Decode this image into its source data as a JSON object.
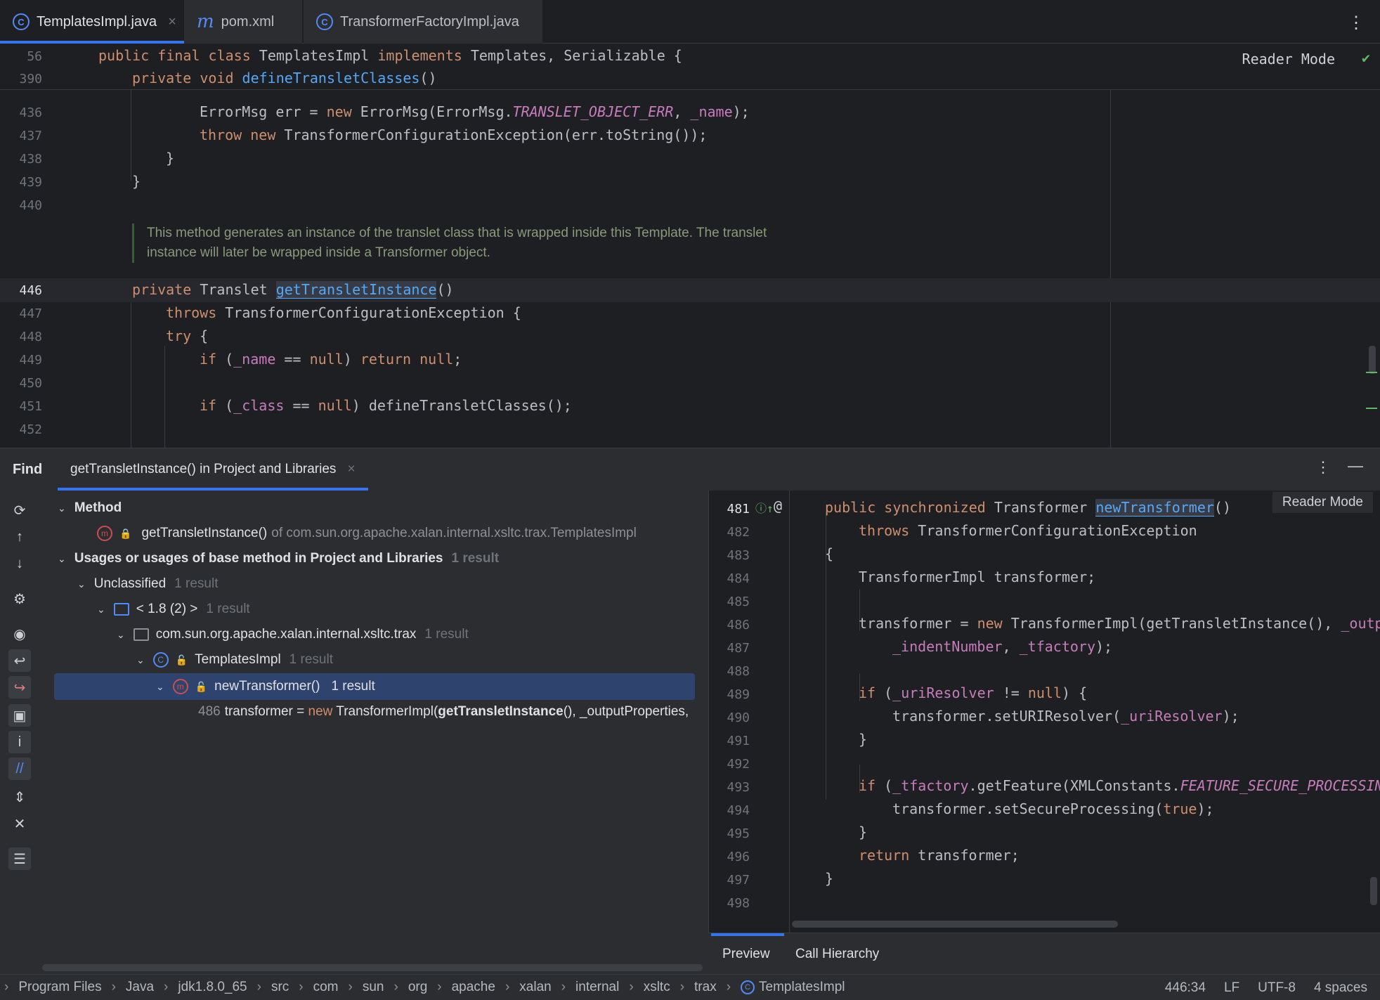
{
  "tabs": [
    {
      "label": "TemplatesImpl.java",
      "icon": "class-icon"
    },
    {
      "label": "pom.xml",
      "icon": "maven-icon"
    },
    {
      "label": "TransformerFactoryImpl.java",
      "icon": "class-icon"
    }
  ],
  "editor": {
    "reader_mode": "Reader Mode",
    "sticky": [
      {
        "line": "56",
        "text": "public final class TemplatesImpl implements Templates, Serializable {"
      },
      {
        "line": "390",
        "text": "private void defineTransletClasses()"
      }
    ],
    "lines": {
      "l436": {
        "num": "436"
      },
      "l437": {
        "num": "437"
      },
      "l438": {
        "num": "438"
      },
      "l439": {
        "num": "439"
      },
      "l440": {
        "num": "440"
      },
      "l446": {
        "num": "446"
      },
      "l447": {
        "num": "447"
      },
      "l448": {
        "num": "448"
      },
      "l449": {
        "num": "449"
      },
      "l450": {
        "num": "450"
      },
      "l451": {
        "num": "451"
      },
      "l452": {
        "num": "452"
      }
    },
    "doc_comment": "This method generates an instance of the translet class that is wrapped inside this Template. The translet instance will later be wrapped inside a Transformer object."
  },
  "find": {
    "title": "Find",
    "tab_label": "getTransletInstance() in Project and Libraries",
    "tree": {
      "method_header": "Method",
      "method_name": "getTransletInstance()",
      "method_of": "of com.sun.org.apache.xalan.internal.xsltc.trax.TemplatesImpl",
      "usages_header": "Usages or usages of base method in Project and Libraries",
      "usages_count": "1 result",
      "unclassified": "Unclassified",
      "unclassified_count": "1 result",
      "jdk": "< 1.8 (2) >",
      "jdk_count": "1 result",
      "package": "com.sun.org.apache.xalan.internal.xsltc.trax",
      "package_count": "1 result",
      "class": "TemplatesImpl",
      "class_count": "1 result",
      "selected_method": "newTransformer()",
      "selected_count": "1 result",
      "usage_line": "486",
      "usage_pre": "transformer = ",
      "usage_kw": "new",
      "usage_mid": " TransformerImpl(",
      "usage_bold": "getTransletInstance",
      "usage_post": "(), _outputProperties,"
    }
  },
  "preview": {
    "reader_mode": "Reader Mode",
    "line_numbers": [
      "481",
      "482",
      "483",
      "484",
      "485",
      "486",
      "487",
      "488",
      "489",
      "490",
      "491",
      "492",
      "493",
      "494",
      "495",
      "496",
      "497",
      "498"
    ],
    "tabs": [
      "Preview",
      "Call Hierarchy"
    ]
  },
  "status": {
    "breadcrumbs": [
      "Program Files",
      "Java",
      "jdk1.8.0_65",
      "src",
      "com",
      "sun",
      "org",
      "apache",
      "xalan",
      "internal",
      "xsltc",
      "trax",
      "TemplatesImpl"
    ],
    "position": "446:34",
    "line_sep": "LF",
    "encoding": "UTF-8",
    "indent": "4 spaces"
  },
  "colors": {
    "accent": "#3574f0",
    "keyword": "#cf8e6d",
    "function": "#56a8f5",
    "field": "#c77dbb"
  }
}
